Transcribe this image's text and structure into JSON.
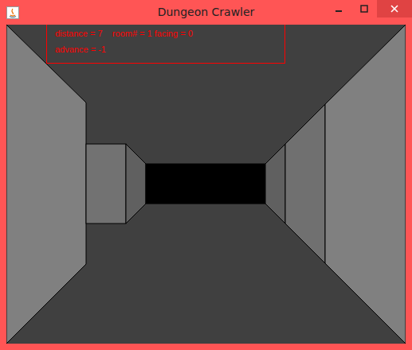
{
  "window": {
    "title": "Dungeon Crawler"
  },
  "debug": {
    "lines": [
      "distance = 7    room# = 1 facing = 0",
      "advance = -1"
    ]
  }
}
